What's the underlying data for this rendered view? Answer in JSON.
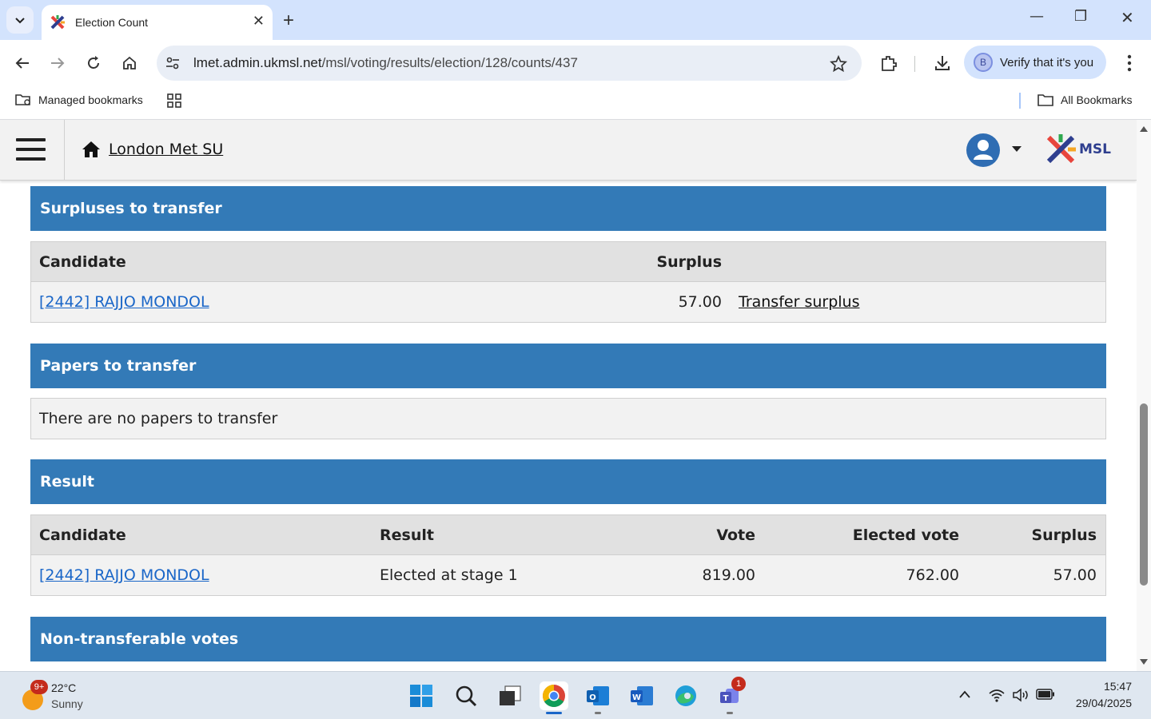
{
  "browser": {
    "tab_title": "Election Count",
    "url_host": "lmet.admin.ukmsl.net",
    "url_path": "/msl/voting/results/election/128/counts/437",
    "verify_label": "Verify that it's you",
    "profile_initial": "B",
    "bookmarks": {
      "managed": "Managed bookmarks",
      "all": "All Bookmarks"
    }
  },
  "header": {
    "site_name": "London Met SU",
    "logo_text": "MSL"
  },
  "surpluses": {
    "title": "Surpluses to transfer",
    "columns": [
      "Candidate",
      "Surplus"
    ],
    "rows": [
      {
        "candidate": "[2442] RAJJO MONDOL",
        "surplus": "57.00",
        "action": "Transfer surplus"
      }
    ]
  },
  "papers": {
    "title": "Papers to transfer",
    "empty_message": "There are no papers to transfer"
  },
  "result": {
    "title": "Result",
    "columns": [
      "Candidate",
      "Result",
      "Vote",
      "Elected vote",
      "Surplus"
    ],
    "rows": [
      {
        "candidate": "[2442] RAJJO MONDOL",
        "result": "Elected at stage 1",
        "vote": "819.00",
        "elected_vote": "762.00",
        "surplus": "57.00"
      }
    ]
  },
  "nontransferable": {
    "title": "Non-transferable votes"
  },
  "taskbar": {
    "weather_temp": "22°C",
    "weather_desc": "Sunny",
    "weather_badge": "9+",
    "teams_badge": "1",
    "time": "15:47",
    "date": "29/04/2025"
  },
  "colors": {
    "section_header": "#337ab7",
    "link": "#1a66c8",
    "tab_strip": "#d3e3fd"
  }
}
